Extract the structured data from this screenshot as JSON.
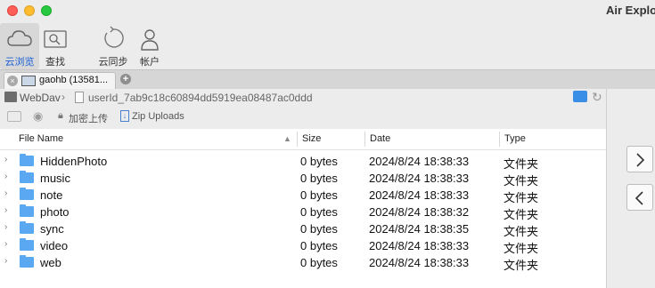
{
  "window": {
    "title": "Air Explo"
  },
  "toolbar": {
    "items": [
      {
        "label": "云浏览",
        "icon": "cloud-icon"
      },
      {
        "label": "查找",
        "icon": "search-icon"
      },
      {
        "label": "云同步",
        "icon": "sync-icon"
      },
      {
        "label": "帐户",
        "icon": "account-icon"
      }
    ]
  },
  "tab": {
    "label": "gaohb (13581...",
    "close_symbol": "×",
    "add_symbol": "+"
  },
  "path": {
    "root": "WebDav",
    "separator": "›",
    "folder": "userId_7ab9c18c60894dd5919ea08487ac0ddd"
  },
  "actions": {
    "upload_label": "加密上传",
    "zip_label": "Zip Uploads"
  },
  "columns": {
    "name": "File Name",
    "size": "Size",
    "date": "Date",
    "type": "Type"
  },
  "files": [
    {
      "name": "HiddenPhoto",
      "size": "0 bytes",
      "date": "2024/8/24 18:38:33",
      "type": "文件夹"
    },
    {
      "name": "music",
      "size": "0 bytes",
      "date": "2024/8/24 18:38:33",
      "type": "文件夹"
    },
    {
      "name": "note",
      "size": "0 bytes",
      "date": "2024/8/24 18:38:33",
      "type": "文件夹"
    },
    {
      "name": "photo",
      "size": "0 bytes",
      "date": "2024/8/24 18:38:32",
      "type": "文件夹"
    },
    {
      "name": "sync",
      "size": "0 bytes",
      "date": "2024/8/24 18:38:35",
      "type": "文件夹"
    },
    {
      "name": "video",
      "size": "0 bytes",
      "date": "2024/8/24 18:38:33",
      "type": "文件夹"
    },
    {
      "name": "web",
      "size": "0 bytes",
      "date": "2024/8/24 18:38:33",
      "type": "文件夹"
    }
  ],
  "colors": {
    "accent": "#1a5fd6",
    "folder": "#5aa7f2"
  }
}
